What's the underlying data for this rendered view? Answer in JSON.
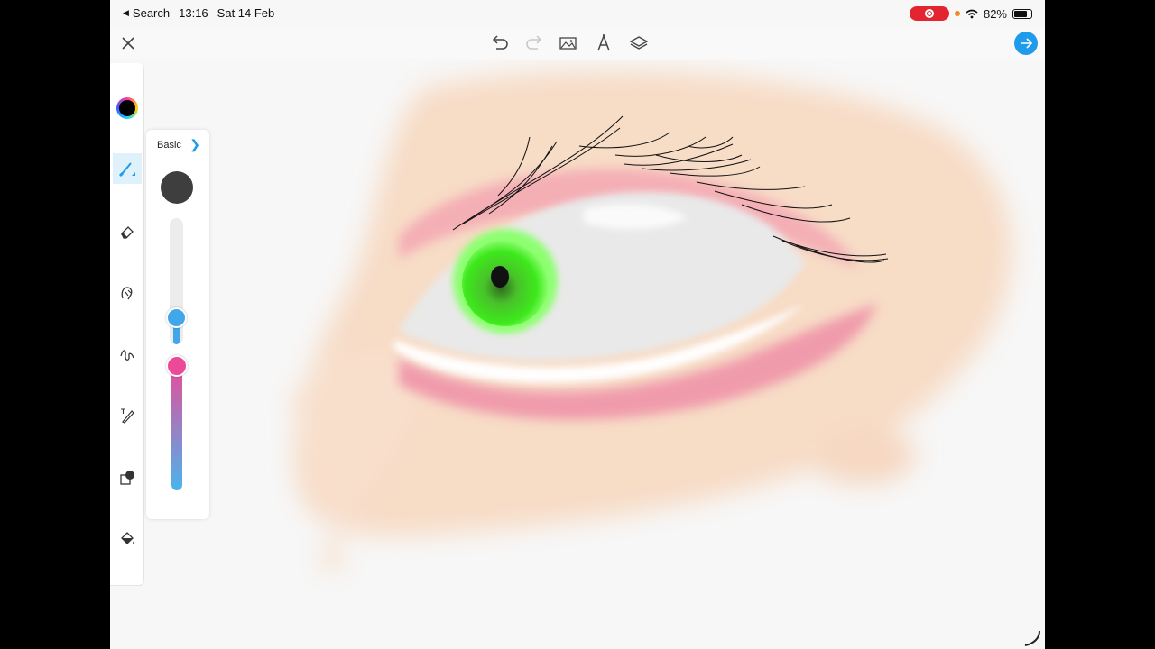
{
  "status": {
    "back_label": "Search",
    "time": "13:16",
    "date": "Sat 14 Feb",
    "battery": "82%",
    "battery_level": 0.82
  },
  "colors": {
    "accent": "#1e9bea",
    "record": "#e3252f",
    "current_color": "#000000",
    "brush_preview": "#3e3e3e",
    "opacity_top": "#ec4a98",
    "opacity_bottom": "#4ab4ec"
  },
  "toolbar": {
    "icons": [
      "close-icon",
      "undo-icon",
      "redo-icon",
      "image-icon",
      "text-icon",
      "layers-icon",
      "arrow-right-icon"
    ]
  },
  "tools": [
    {
      "name": "color-picker",
      "icon": "color-wheel-icon",
      "active": false
    },
    {
      "name": "brush",
      "icon": "brush-icon",
      "active": true
    },
    {
      "name": "eraser",
      "icon": "eraser-icon",
      "active": false
    },
    {
      "name": "smudge",
      "icon": "smudge-icon",
      "active": false
    },
    {
      "name": "line",
      "icon": "squiggle-icon",
      "active": false
    },
    {
      "name": "text",
      "icon": "text-pen-icon",
      "active": false
    },
    {
      "name": "shape",
      "icon": "shape-icon",
      "active": false
    },
    {
      "name": "fill",
      "icon": "bucket-icon",
      "active": false
    }
  ],
  "brush_panel": {
    "title": "Basic",
    "size_level": 0.15,
    "opacity_level": 1.0
  }
}
